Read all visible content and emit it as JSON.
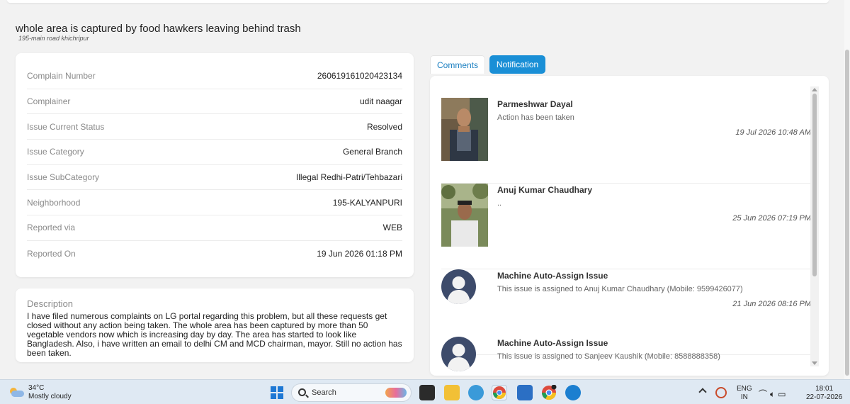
{
  "page": {
    "title": "whole area is captured by food hawkers leaving behind trash",
    "subtitle": "195-main road khichripur"
  },
  "details": [
    {
      "label": "Complain Number",
      "value": "260619161020423134"
    },
    {
      "label": "Complainer",
      "value": "udit naagar"
    },
    {
      "label": "Issue Current Status",
      "value": "Resolved"
    },
    {
      "label": "Issue Category",
      "value": "General Branch"
    },
    {
      "label": "Issue SubCategory",
      "value": "Illegal Redhi-Patri/Tehbazari"
    },
    {
      "label": "Neighborhood",
      "value": "195-KALYANPURI"
    },
    {
      "label": "Reported via",
      "value": "WEB"
    },
    {
      "label": "Reported On",
      "value": "19 Jun 2026 01:18 PM"
    }
  ],
  "description": {
    "title": "Description",
    "text": "I have filed numerous complaints on LG portal regarding this problem, but all these requests get closed without any action being taken. The whole area has been captured by more than 50 vegetable vendors now which is increasing day by day. The area has started to look like Bangladesh. Also, i have written an email to delhi CM and MCD chairman, mayor. Still no action has been taken."
  },
  "tabs": {
    "comments": "Comments",
    "notification": "Notification",
    "active": "notification"
  },
  "feed": [
    {
      "name": "Parmeshwar Dayal",
      "message": "Action has been taken",
      "time": "19 Jul 2026 10:48 AM",
      "avatar": "photo"
    },
    {
      "name": "Anuj Kumar Chaudhary",
      "message": "..",
      "time": "25 Jun 2026 07:19 PM",
      "avatar": "photo"
    },
    {
      "name": "Machine Auto-Assign Issue",
      "message": "This issue is assigned to Anuj Kumar Chaudhary (Mobile: 9599426077)",
      "time": "21 Jun 2026 08:16 PM",
      "avatar": "default-user-icon"
    },
    {
      "name": "Machine Auto-Assign Issue",
      "message": "This issue is assigned to Sanjeev Kaushik (Mobile: 8588888358)",
      "time": "",
      "avatar": "default-user-icon"
    }
  ],
  "taskbar": {
    "weather_temp": "34°C",
    "weather_desc": "Mostly cloudy",
    "search_placeholder": "Search",
    "lang_1": "ENG",
    "lang_2": "IN",
    "time": "18:01",
    "date": "22-07-2026"
  },
  "colors": {
    "accent": "#1a8fd6",
    "avatar_bg": "#3d4b6b"
  }
}
